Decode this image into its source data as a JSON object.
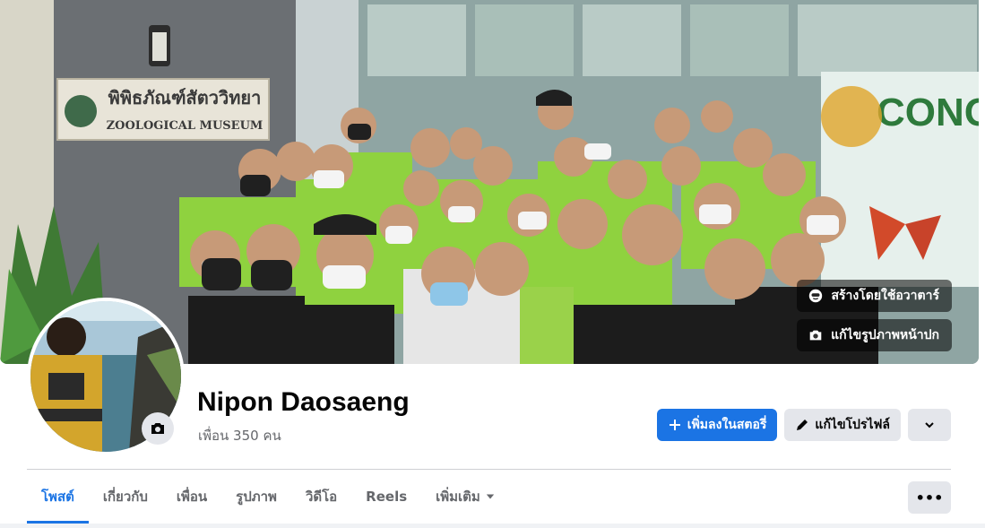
{
  "profile": {
    "name": "Nipon Daosaeng",
    "friends_label": "เพื่อน 350 คน"
  },
  "cover": {
    "create_avatar_label": "สร้างโดยใช้อวาตาร์",
    "edit_cover_label": "แก้ไขรูปภาพหน้าปก",
    "sign_thai": "พิพิธภัณฑ์สัตววิทยา",
    "sign_english": "ZOOLOGICAL MUSEUM",
    "banner_text": "CONG"
  },
  "actions": {
    "add_story_label": "เพิ่มลงในสตอรี่",
    "edit_profile_label": "แก้ไขโปรไฟล์"
  },
  "tabs": [
    {
      "label": "โพสต์",
      "active": true
    },
    {
      "label": "เกี่ยวกับ",
      "active": false
    },
    {
      "label": "เพื่อน",
      "active": false
    },
    {
      "label": "รูปภาพ",
      "active": false
    },
    {
      "label": "วิดีโอ",
      "active": false
    },
    {
      "label": "Reels",
      "active": false
    },
    {
      "label": "เพิ่มเติม",
      "active": false
    }
  ],
  "more_dots": "•••",
  "colors": {
    "accent": "#1b74e4",
    "shirt_green": "#8fd23f",
    "secondary_button": "#e4e6eb"
  }
}
